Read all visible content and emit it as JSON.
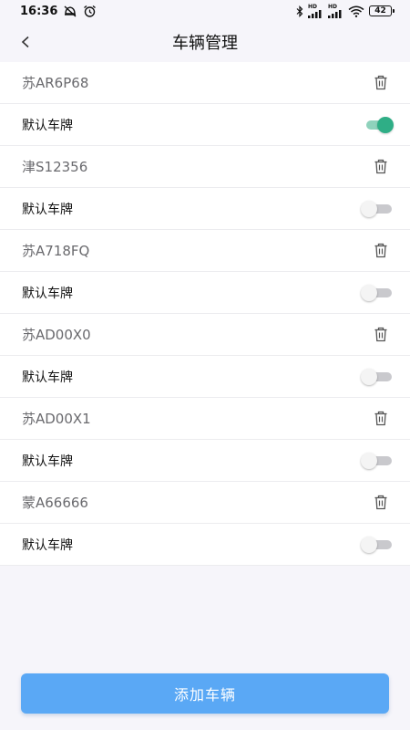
{
  "status_bar": {
    "time": "16:36",
    "net_label_1": "HD",
    "net_label_2": "HD",
    "battery": "42"
  },
  "nav": {
    "title": "车辆管理"
  },
  "vehicles": [
    {
      "plate": "苏AR6P68",
      "default_label": "默认车牌",
      "is_default": true
    },
    {
      "plate": "津S12356",
      "default_label": "默认车牌",
      "is_default": false
    },
    {
      "plate": "苏A718FQ",
      "default_label": "默认车牌",
      "is_default": false
    },
    {
      "plate": "苏AD00X0",
      "default_label": "默认车牌",
      "is_default": false
    },
    {
      "plate": "苏AD00X1",
      "default_label": "默认车牌",
      "is_default": false
    },
    {
      "plate": "蒙A66666",
      "default_label": "默认车牌",
      "is_default": false
    }
  ],
  "add_button_label": "添加车辆",
  "colors": {
    "accent_button": "#5aa8f5",
    "toggle_on": "#2fae86",
    "toggle_off": "#c9c9cd",
    "background": "#f6f5fa"
  },
  "icons": [
    "back-chevron-icon",
    "trash-icon",
    "bluetooth-icon",
    "signal-icon",
    "wifi-icon",
    "alarm-icon",
    "no-disturb-icon"
  ]
}
